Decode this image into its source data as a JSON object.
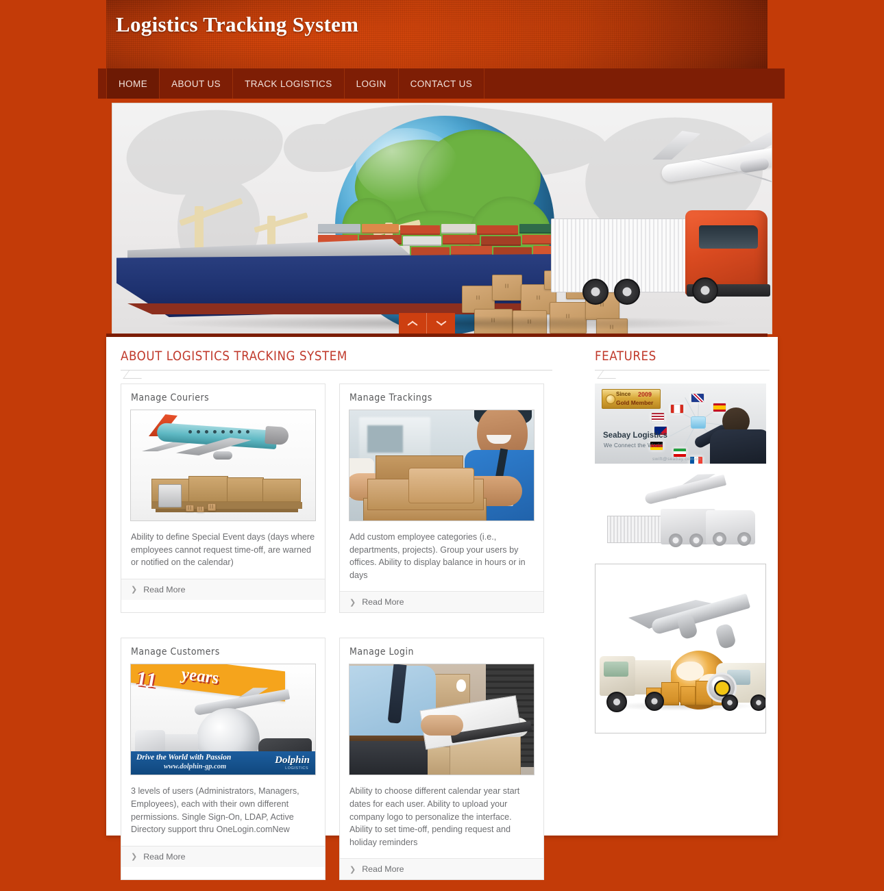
{
  "header": {
    "site_title": "Logistics Tracking System",
    "brand_color": "#c33b08",
    "nav_bg_color": "#7e1e05"
  },
  "nav": {
    "items": [
      {
        "label": "HOME",
        "active": true
      },
      {
        "label": "ABOUT US",
        "active": false
      },
      {
        "label": "TRACK LOGISTICS",
        "active": false
      },
      {
        "label": "LOGIN",
        "active": false
      },
      {
        "label": "CONTACT US",
        "active": false
      }
    ]
  },
  "slider": {
    "prev_icon": "chevron-up-icon",
    "next_icon": "chevron-down-icon"
  },
  "main": {
    "section_title": "ABOUT LOGISTICS TRACKING SYSTEM",
    "heading_color": "#c0392b",
    "cards": [
      {
        "title": "Manage Couriers",
        "description": "Ability to define Special Event days (days where employees cannot request time-off, are warned or notified on the calendar)",
        "read_more": "Read More",
        "image_name": "airplane-over-cargo-pallets"
      },
      {
        "title": "Manage Trackings",
        "description": "Add custom employee categories (i.e., departments, projects). Group your users by offices. Ability to display balance in hours or in days",
        "read_more": "Read More",
        "image_name": "courier-handing-parcel"
      },
      {
        "title": "Manage Customers",
        "description": "3 levels of users (Administrators, Managers, Employees), each with their own different permissions. Single Sign-On, LDAP, Active Directory support thru OneLogin.comNew",
        "read_more": "Read More",
        "image_name": "china-logistics-banner"
      },
      {
        "title": "Manage Login",
        "description": "Ability to choose different calendar year start dates for each user. Ability to upload your company logo to personalize the interface. Ability to set time-off, pending request and holiday reminders",
        "read_more": "Read More",
        "image_name": "warehouse-clipboard-inspection"
      }
    ]
  },
  "sidebar": {
    "section_title": "FEATURES",
    "images": [
      {
        "image_name": "seabay-logistics-banner",
        "badge_prefix": "Since",
        "badge_year": "2009",
        "badge_tier": "Gold Member",
        "company": "Seabay Logistics",
        "tagline": "We Connect the World",
        "contact": "swift@seabay.com.cn"
      },
      {
        "image_name": "monochrome-plane-container-train-truck"
      },
      {
        "image_name": "global-freight-plane-truck-van-globe"
      }
    ]
  }
}
